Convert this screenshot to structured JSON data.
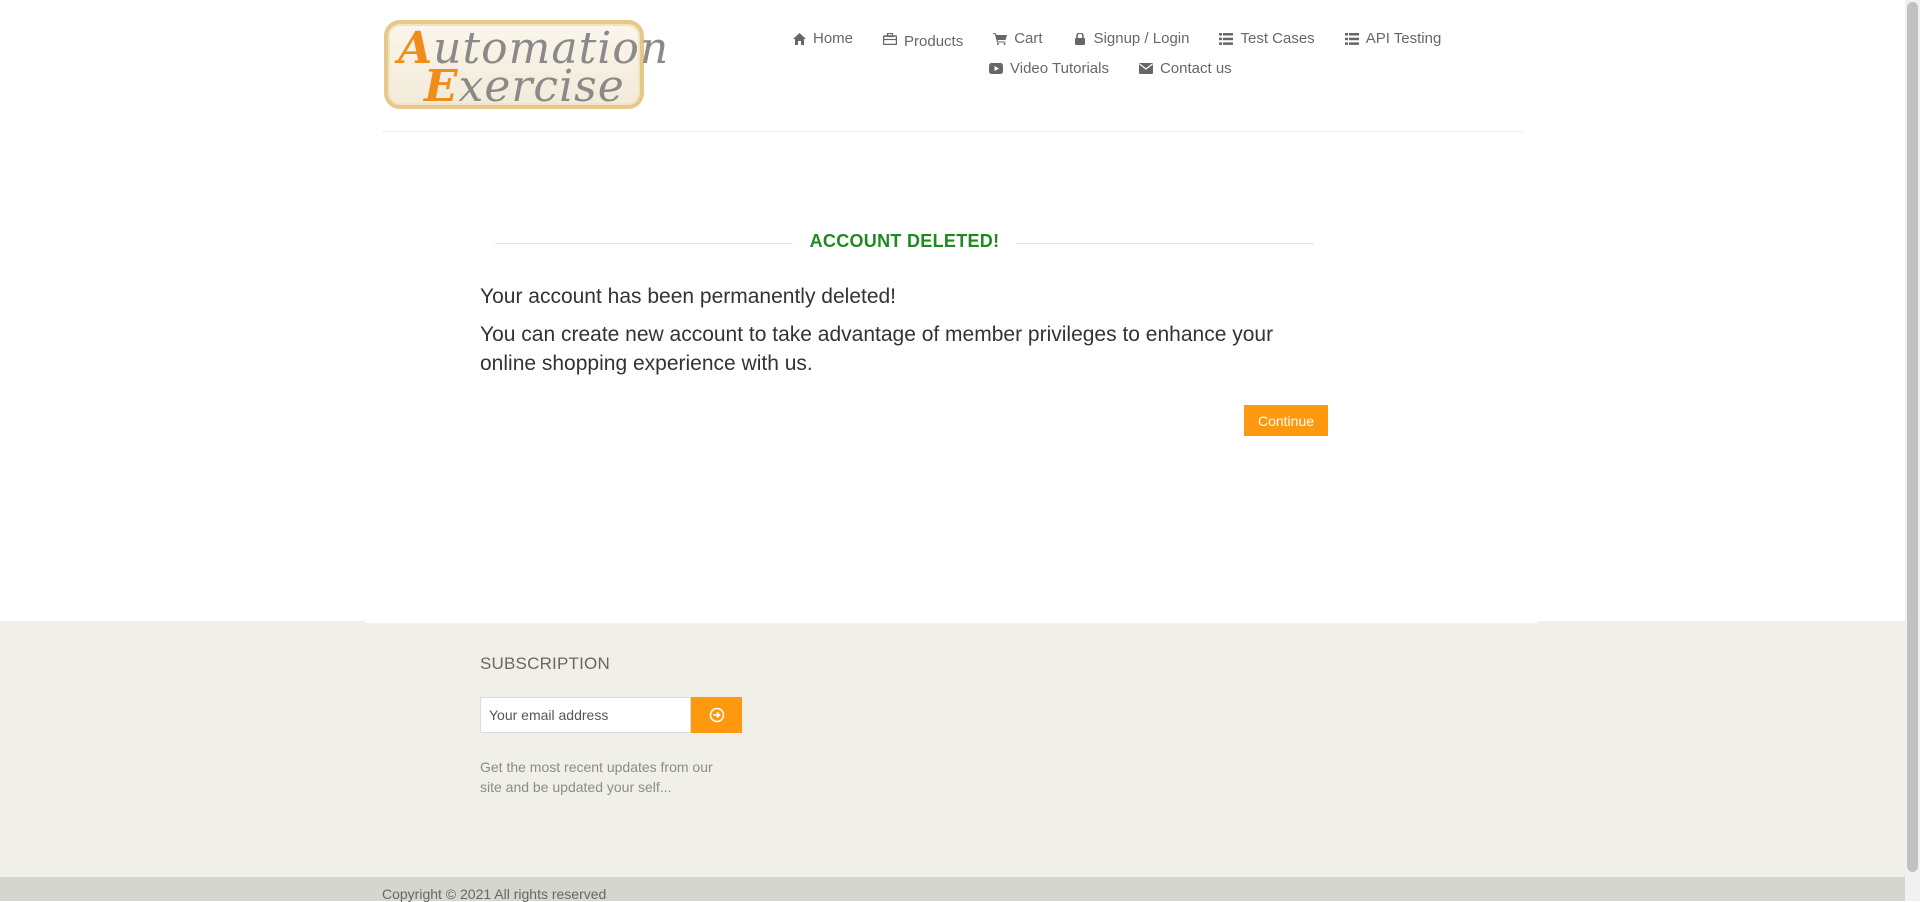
{
  "logo": {
    "line1_cap": "A",
    "line1_rest": "utomation",
    "line2_cap": "E",
    "line2_rest": "xercise"
  },
  "nav": {
    "row1": [
      {
        "label": "Home",
        "icon": "home-icon"
      },
      {
        "label": "Products",
        "icon": "products-icon"
      },
      {
        "label": "Cart",
        "icon": "cart-icon"
      },
      {
        "label": "Signup / Login",
        "icon": "lock-icon"
      },
      {
        "label": "Test Cases",
        "icon": "list-icon"
      },
      {
        "label": "API Testing",
        "icon": "list-icon"
      }
    ],
    "row2": [
      {
        "label": "Video Tutorials",
        "icon": "youtube-icon"
      },
      {
        "label": "Contact us",
        "icon": "envelope-icon"
      }
    ]
  },
  "main": {
    "title": "ACCOUNT DELETED!",
    "message1": "Your account has been permanently deleted!",
    "message2": "You can create new account to take advantage of member privileges to enhance your online shopping experience with us.",
    "continue_label": "Continue"
  },
  "footer": {
    "subscription_title": "SUBSCRIPTION",
    "email_placeholder": "Your email address",
    "description": "Get the most recent updates from our site and be updated your self...",
    "copyright": "Copyright © 2021 All rights reserved"
  },
  "colors": {
    "accent": "#fe980f",
    "success": "#1f8a1f",
    "footer_bg": "#f0f0e9"
  }
}
